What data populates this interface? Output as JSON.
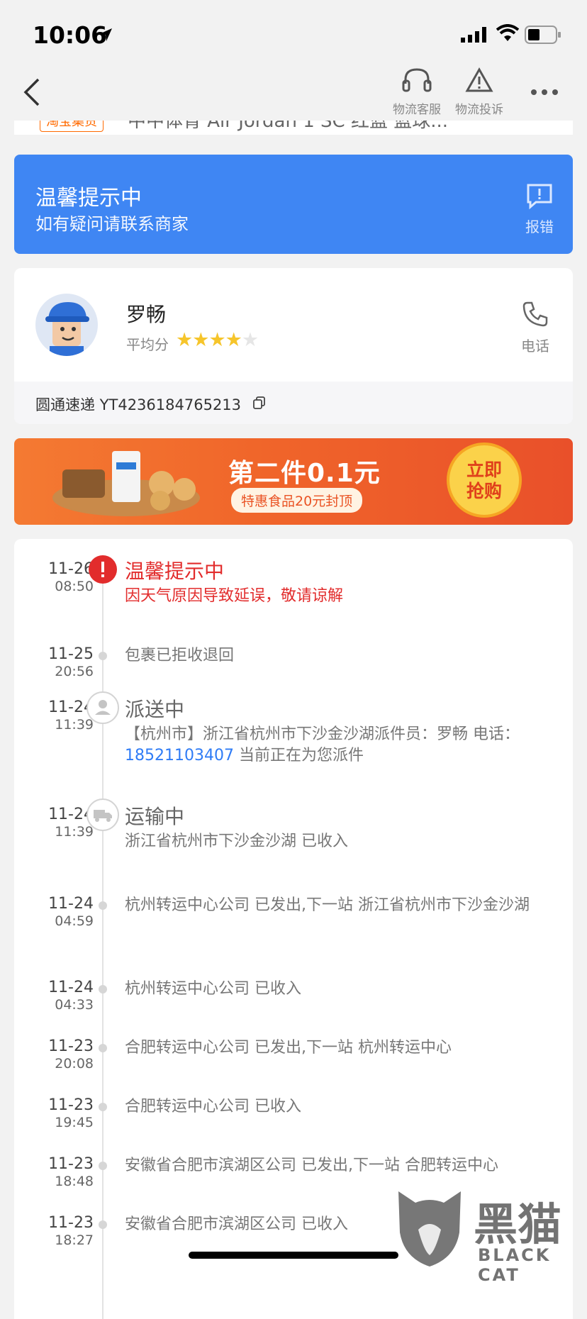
{
  "status_bar": {
    "time": "10:06"
  },
  "nav": {
    "service_label": "物流客服",
    "complaint_label": "物流投诉"
  },
  "peek": {
    "badge": "淘宝集货",
    "title": "中中体育 Air Jordan 1 SC 红蓝 篮球..."
  },
  "notice": {
    "title": "温馨提示中",
    "subtitle": "如有疑问请联系商家",
    "report_label": "报错"
  },
  "courier": {
    "name": "罗畅",
    "rating_label": "平均分",
    "rating_value": 4,
    "rating_max": 5,
    "call_label": "电话",
    "tracking": "圆通速递 YT4236184765213"
  },
  "banner": {
    "main": "第二件0.1元",
    "sub": "特惠食品20元封顶",
    "button_line1": "立即",
    "button_line2": "抢购"
  },
  "timeline": [
    {
      "date": "11-26",
      "time": "08:50",
      "title": "温馨提示中",
      "desc": "因天气原因导致延误，敬请谅解",
      "kind": "alert"
    },
    {
      "date": "11-25",
      "time": "20:56",
      "desc": "包裹已拒收退回",
      "kind": "dot"
    },
    {
      "date": "11-24",
      "time": "11:39",
      "title": "派送中",
      "desc_prefix": "【杭州市】浙江省杭州市下沙金沙湖派件员：罗畅 电话：",
      "phone": "18521103407",
      "desc_suffix": " 当前正在为您派件",
      "kind": "person"
    },
    {
      "date": "11-24",
      "time": "11:39",
      "title": "运输中",
      "desc": "浙江省杭州市下沙金沙湖 已收入",
      "kind": "truck"
    },
    {
      "date": "11-24",
      "time": "04:59",
      "desc": "杭州转运中心公司 已发出,下一站 浙江省杭州市下沙金沙湖",
      "kind": "dot"
    },
    {
      "date": "11-24",
      "time": "04:33",
      "desc": "杭州转运中心公司 已收入",
      "kind": "dot"
    },
    {
      "date": "11-23",
      "time": "20:08",
      "desc": "合肥转运中心公司 已发出,下一站 杭州转运中心",
      "kind": "dot"
    },
    {
      "date": "11-23",
      "time": "19:45",
      "desc": "合肥转运中心公司 已收入",
      "kind": "dot"
    },
    {
      "date": "11-23",
      "time": "18:48",
      "desc": "安徽省合肥市滨湖区公司 已发出,下一站 合肥转运中心",
      "kind": "dot"
    },
    {
      "date": "11-23",
      "time": "18:27",
      "desc": "安徽省合肥市滨湖区公司 已收入",
      "kind": "dot"
    }
  ],
  "watermark": {
    "title": "黑猫",
    "subtitle": "BLACK CAT"
  }
}
